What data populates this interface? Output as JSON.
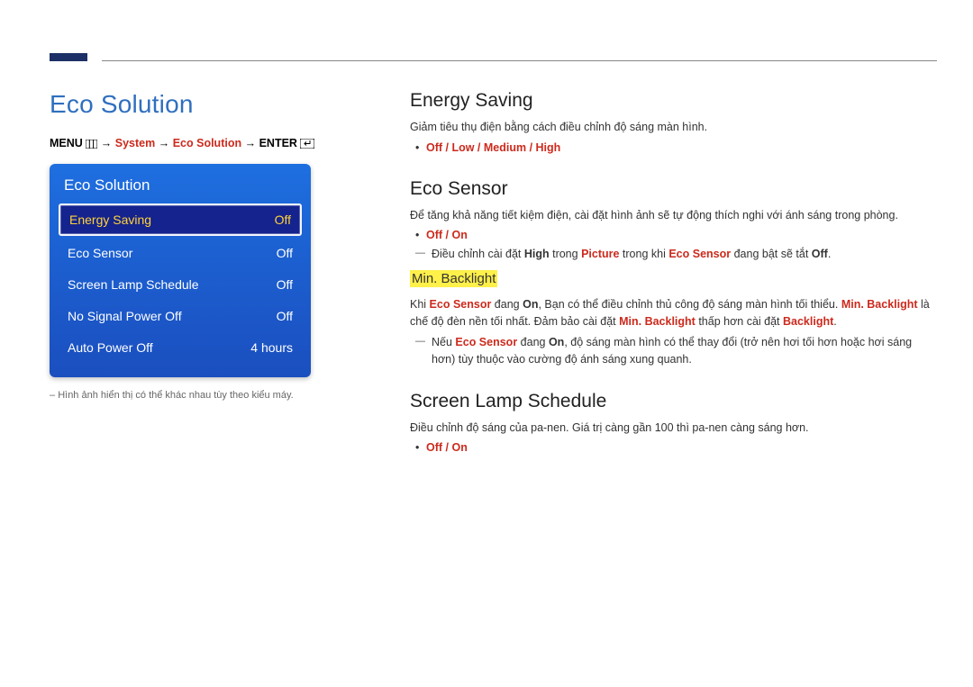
{
  "page_title": "Eco Solution",
  "menupath": {
    "menu": "MENU",
    "arrow": "→",
    "system": "System",
    "eco": "Eco Solution",
    "enter": "ENTER"
  },
  "panel": {
    "title": "Eco Solution",
    "rows": [
      {
        "label": "Energy Saving",
        "value": "Off",
        "selected": true
      },
      {
        "label": "Eco Sensor",
        "value": "Off",
        "selected": false
      },
      {
        "label": "Screen Lamp Schedule",
        "value": "Off",
        "selected": false
      },
      {
        "label": "No Signal Power Off",
        "value": "Off",
        "selected": false
      },
      {
        "label": "Auto Power Off",
        "value": "4 hours",
        "selected": false
      }
    ]
  },
  "footnote": "Hình ảnh hiển thị có thể khác nhau tùy theo kiểu máy.",
  "energy": {
    "h": "Energy Saving",
    "desc": "Giảm tiêu thụ điện bằng cách điều chỉnh độ sáng màn hình.",
    "opts": "Off / Low / Medium / High"
  },
  "eco": {
    "h": "Eco Sensor",
    "desc": "Để tăng khả năng tiết kiệm điện, cài đặt hình ảnh sẽ tự động thích nghi với ánh sáng trong phòng.",
    "opts": "Off / On",
    "dash1_pre": "Điều chỉnh cài đặt ",
    "dash1_high": "High",
    "dash1_mid1": " trong ",
    "dash1_picture": "Picture",
    "dash1_mid2": " trong khi ",
    "dash1_ecosensor": "Eco Sensor",
    "dash1_mid3": " đang bật sẽ tắt ",
    "dash1_off": "Off",
    "dash1_end": ".",
    "min_h": "Min. Backlight",
    "min_p_pre": "Khi ",
    "min_p_es": "Eco Sensor",
    "min_p_mid1": " đang ",
    "min_p_on": "On",
    "min_p_mid2": ", Bạn có thể điều chỉnh thủ công độ sáng màn hình tối thiểu. ",
    "min_p_mb": "Min. Backlight",
    "min_p_mid3": " là chế độ đèn nền tối nhất. Đảm bảo cài đặt ",
    "min_p_mb2": "Min. Backlight",
    "min_p_mid4": " thấp hơn cài đặt ",
    "min_p_bl": "Backlight",
    "min_p_end": ".",
    "dash2_pre": "Nếu ",
    "dash2_es": "Eco Sensor",
    "dash2_mid1": " đang ",
    "dash2_on": "On",
    "dash2_rest": ", độ sáng màn hình có thể thay đổi (trở nên hơi tối hơn hoặc hơi sáng hơn) tùy thuộc vào cường độ ánh sáng xung quanh."
  },
  "lamp": {
    "h": "Screen Lamp Schedule",
    "desc": "Điều chỉnh độ sáng của pa-nen. Giá trị càng gần 100 thì pa-nen càng sáng hơn.",
    "opts": "Off / On"
  }
}
